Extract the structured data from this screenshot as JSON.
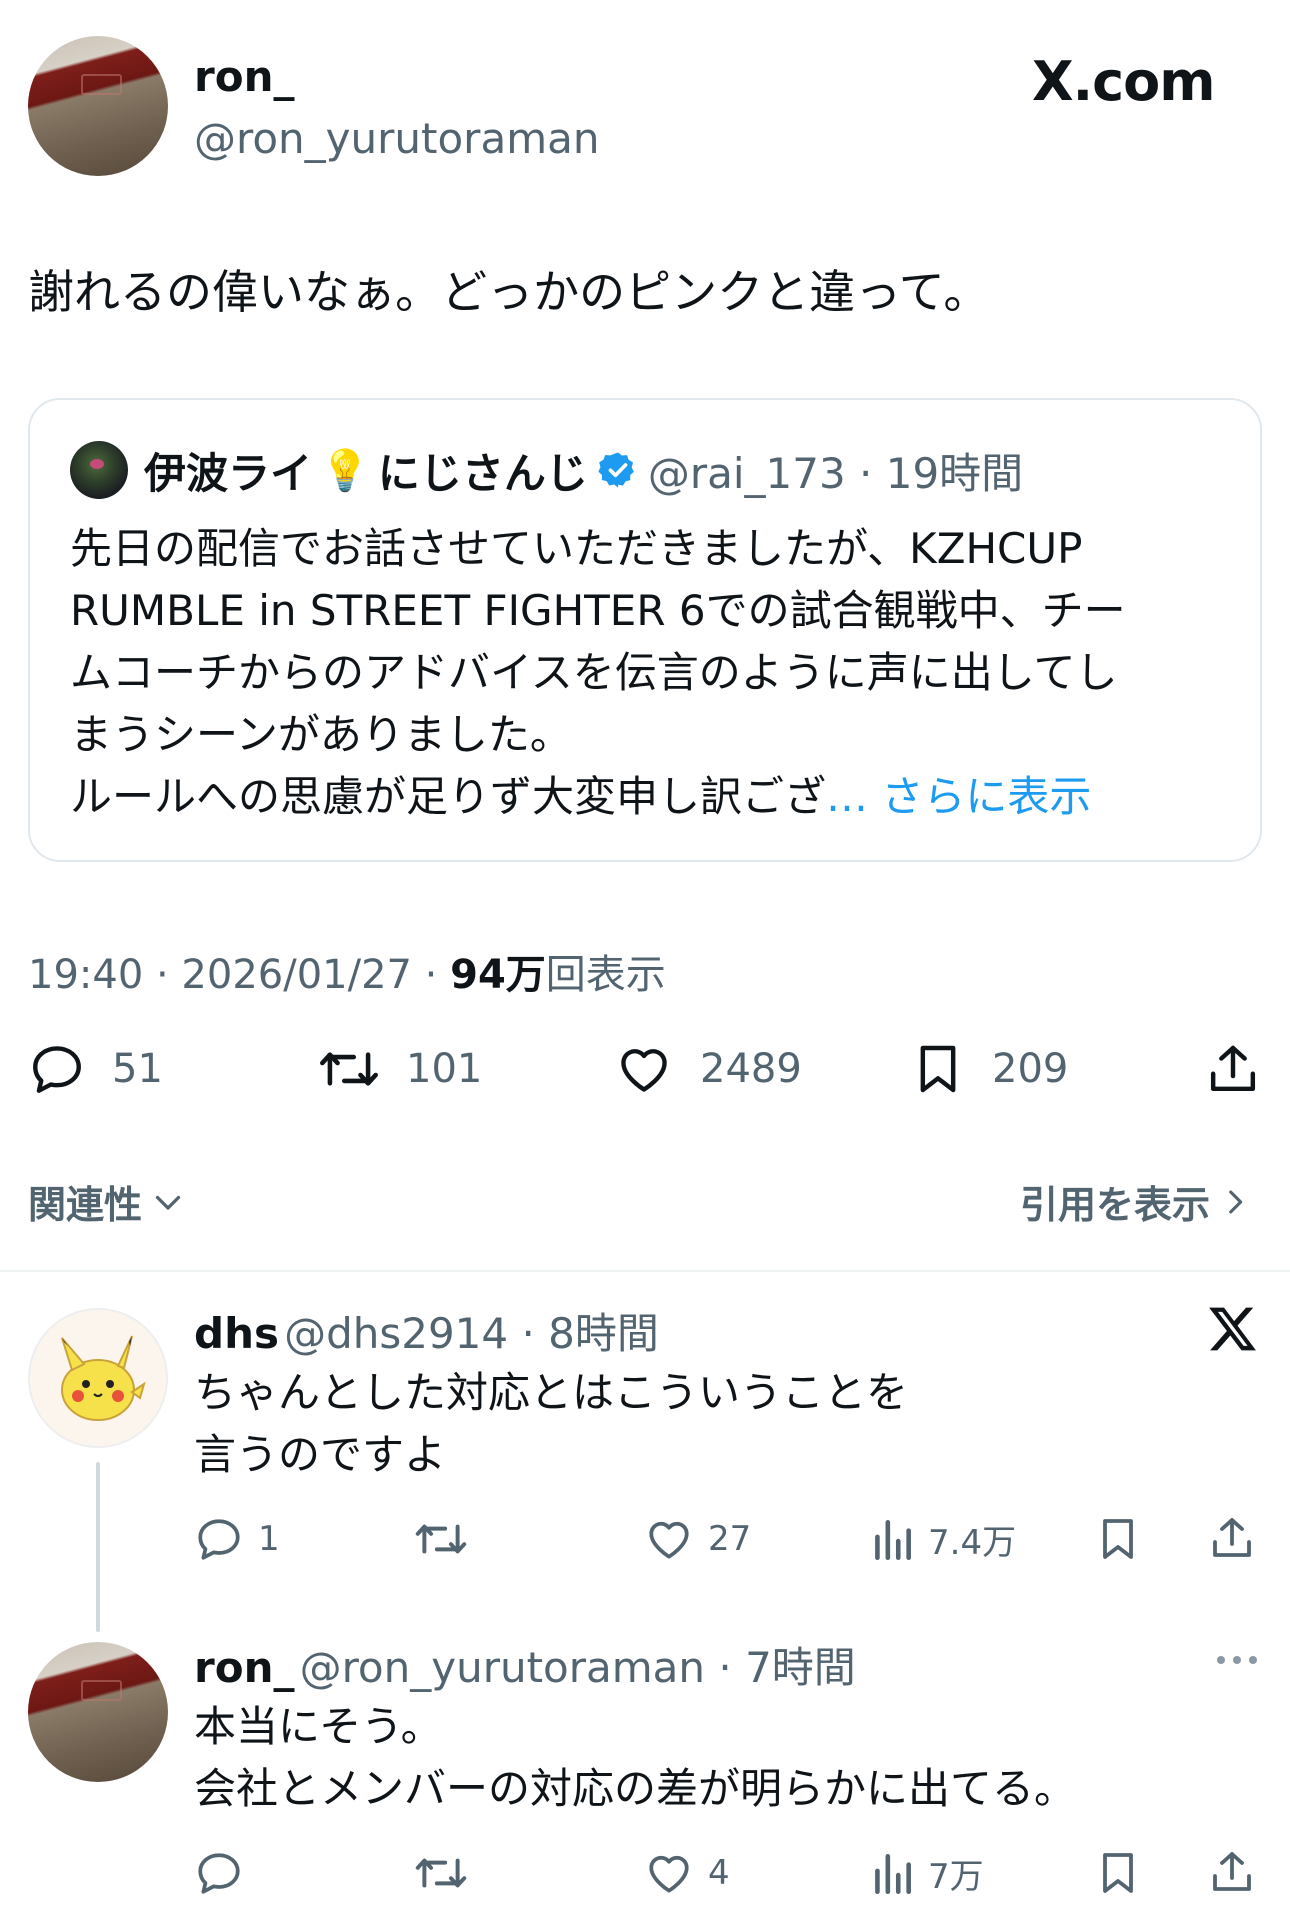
{
  "header": {
    "display_name": "ron_",
    "handle": "@ron_yurutoraman",
    "site": "X.com"
  },
  "tweet": {
    "text": "謝れるの偉いなぁ。どっかのピンクと違って。"
  },
  "quote": {
    "name": "伊波ライ",
    "name_suffix": "にじさんじ",
    "bulb": "💡",
    "handle_time": "@rai_173 · 19時間",
    "body": "先日の配信でお話させていただきましたが、KZHCUP\nRUMBLE in STREET FIGHTER 6での試合観戦中、チー\nムコーチからのアドバイスを伝言のように声に出してし\nまうシーンがありました。\nルールへの思慮が足りず大変申し訳ござ",
    "show_more": "… さらに表示"
  },
  "meta": {
    "time_date": "19:40 · 2026/01/27 · ",
    "views_count": "94万",
    "views_label": "回表示"
  },
  "actions": {
    "replies": "51",
    "reposts": "101",
    "likes": "2489",
    "bookmarks": "209"
  },
  "sort_bar": {
    "relevance": "関連性",
    "view_quotes": "引用を表示"
  },
  "replies": [
    {
      "name": "dhs",
      "meta": "@dhs2914 · 8時間",
      "text": "ちゃんとした対応とはこういうことを\n言うのですよ",
      "replies": "1",
      "likes": "27",
      "views": "7.4万"
    },
    {
      "name": "ron_",
      "meta": "@ron_yurutoraman · 7時間",
      "text": "本当にそう。\n会社とメンバーの対応の差が明らかに出てる。",
      "likes": "4",
      "views": "7万"
    }
  ],
  "colors": {
    "text": "#0f1419",
    "secondary": "#536471",
    "link": "#1d9bf0",
    "verified": "#1d9bf0",
    "border": "#e1e8ed"
  }
}
